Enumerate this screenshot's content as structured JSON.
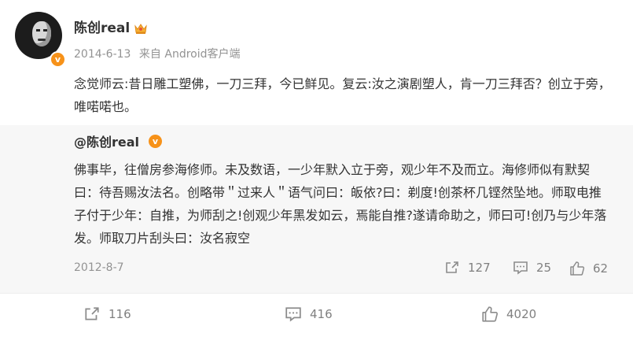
{
  "post": {
    "author": "陈创real",
    "time": "2014-6-13",
    "source_prefix": "来自",
    "source": "Android客户端",
    "text": "念觉师云:昔日雕工塑佛，一刀三拜，今已鲜见。复云:汝之演剧塑人，肯一刀三拜否？创立于旁，唯喏喏也。"
  },
  "repost": {
    "author": "@陈创real",
    "text": "佛事毕，往僧房参海修师。未及数语，一少年默入立于旁，观少年不及而立。海修师似有默契曰：待吾赐汝法名。创略带＂过来人＂语气问曰：皈依?曰：剃度!创茶杯几铿然坠地。师取电推子付于少年：自推，为师刮之!创观少年黑发如云，焉能自推?遂请命助之，师曰可!创乃与少年落发。师取刀片刮头曰：汝名寂空",
    "date": "2012-8-7",
    "actions": {
      "share_count": "127",
      "comment_count": "25",
      "like_count": "62"
    }
  },
  "actions": {
    "share_count": "116",
    "comment_count": "416",
    "like_count": "4020"
  },
  "icons": {
    "verified": "verified-v-badge",
    "crown": "crown-icon",
    "share": "share-icon",
    "comment": "comment-icon",
    "like": "like-icon"
  },
  "colors": {
    "accent_orange": "#f79219",
    "meta_gray": "#939393",
    "repost_bg": "#f7f7f7"
  }
}
